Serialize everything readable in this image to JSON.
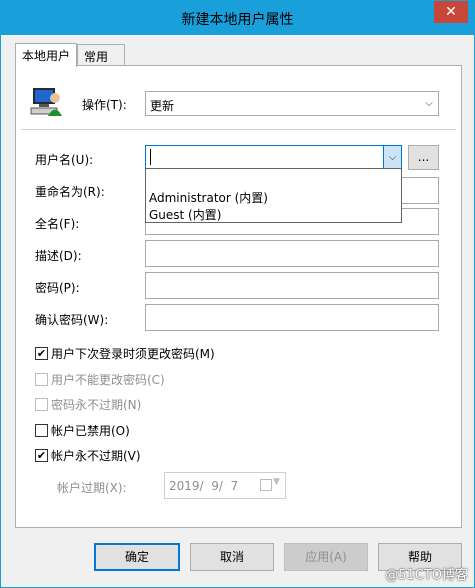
{
  "window": {
    "title": "新建本地用户属性",
    "close": "✕"
  },
  "tabs": [
    {
      "label": "本地用户",
      "active": true
    },
    {
      "label": "常用",
      "active": false
    }
  ],
  "action": {
    "label": "操作(T):",
    "value": "更新"
  },
  "fields": {
    "username_label": "用户名(U):",
    "username_value": "",
    "browse_label": "...",
    "rename_label": "重命名为(R):",
    "fullname_label": "全名(F):",
    "description_label": "描述(D):",
    "password_label": "密码(P):",
    "confirm_label": "确认密码(W):"
  },
  "username_dropdown": {
    "options": [
      "Administrator (内置)",
      "Guest (内置)"
    ]
  },
  "checkboxes": [
    {
      "label": "用户下次登录时须更改密码(M)",
      "checked": true,
      "enabled": true
    },
    {
      "label": "用户不能更改密码(C)",
      "checked": false,
      "enabled": false
    },
    {
      "label": "密码永不过期(N)",
      "checked": false,
      "enabled": false
    },
    {
      "label": "帐户已禁用(O)",
      "checked": false,
      "enabled": true
    },
    {
      "label": "帐户永不过期(V)",
      "checked": true,
      "enabled": true
    }
  ],
  "expiry": {
    "label": "帐户过期(X):",
    "date": "2019/  9/  7"
  },
  "buttons": {
    "ok": "确定",
    "cancel": "取消",
    "apply": "应用(A)",
    "help": "帮助"
  },
  "watermark": "@51CTO博客",
  "colors": {
    "titlebar": "#19a0db",
    "close": "#c7483b",
    "focus": "#0078d7"
  },
  "icons": [
    "user-computer-icon",
    "close-icon",
    "chevron-down-icon",
    "calendar-icon"
  ]
}
